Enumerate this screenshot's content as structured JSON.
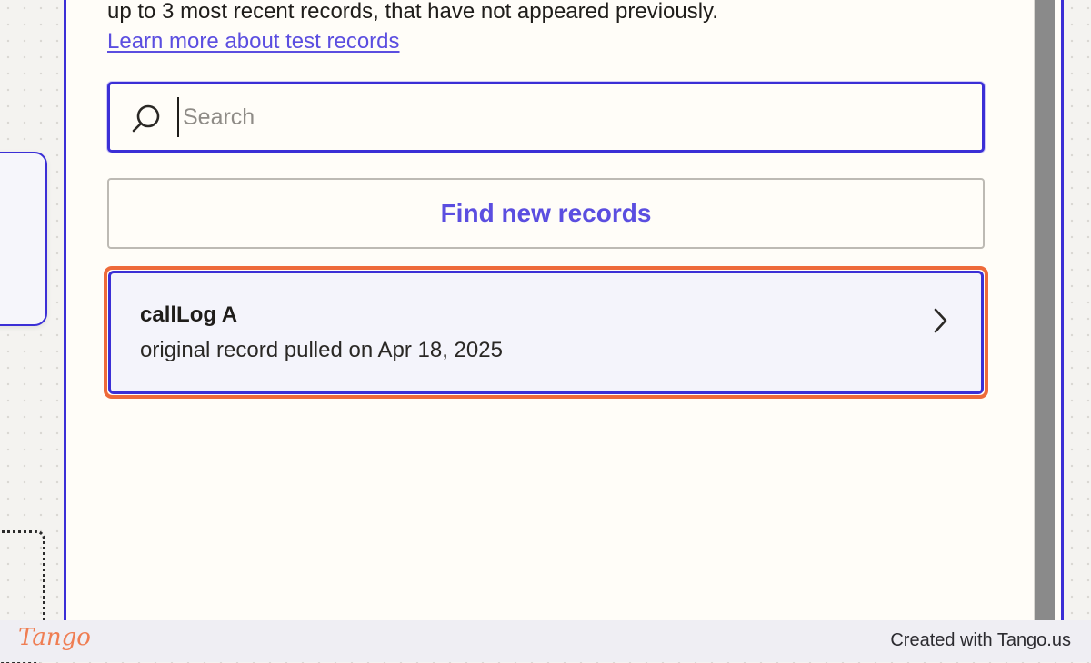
{
  "intro": {
    "text": "up to 3 most recent records, that have not appeared previously.",
    "link_label": "Learn more about test records"
  },
  "search": {
    "placeholder": "Search",
    "value": "",
    "icon": "search-icon"
  },
  "find_button": {
    "label": "Find new records"
  },
  "record": {
    "title": "callLog A",
    "subtitle": "original record pulled on Apr 18, 2025",
    "icon": "chevron-right-icon"
  },
  "footer": {
    "logo_text": "Tango",
    "credit": "Created with Tango.us"
  },
  "colors": {
    "accent": "#3b2fd6",
    "link": "#5b4ee0",
    "highlight": "#ee6a3a",
    "brand": "#ef7d52"
  }
}
